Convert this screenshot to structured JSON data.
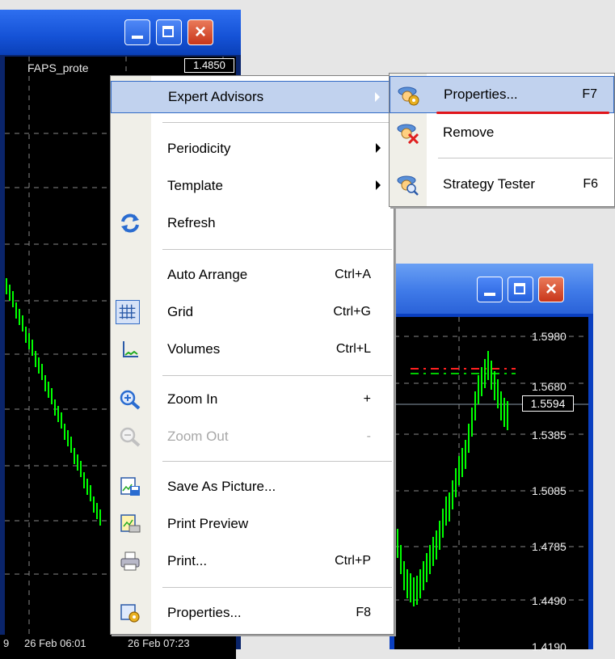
{
  "chart_window_left": {
    "ea_label": "FAPS_prote",
    "price_tag": "1.4850",
    "time_labels": [
      "9",
      "26 Feb 06:01",
      "26 Feb 07:23"
    ]
  },
  "chart_window_right": {
    "price_labels": [
      "1.5980",
      "1.5680",
      "1.5385",
      "1.5085",
      "1.4785",
      "1.4490",
      "1.4190"
    ],
    "current_price": "1.5594"
  },
  "context_menu": {
    "items": [
      {
        "label": "Expert Advisors",
        "shortcut": "",
        "submenu": true,
        "icon": "",
        "state": "highlighted"
      },
      {
        "label": "Periodicity",
        "shortcut": "",
        "submenu": true,
        "icon": ""
      },
      {
        "label": "Template",
        "shortcut": "",
        "submenu": true,
        "icon": ""
      },
      {
        "label": "Refresh",
        "shortcut": "",
        "submenu": false,
        "icon": "refresh-icon"
      },
      {
        "label": "Auto Arrange",
        "shortcut": "Ctrl+A",
        "submenu": false,
        "icon": ""
      },
      {
        "label": "Grid",
        "shortcut": "Ctrl+G",
        "submenu": false,
        "icon": "grid-icon",
        "checked": true
      },
      {
        "label": "Volumes",
        "shortcut": "Ctrl+L",
        "submenu": false,
        "icon": "volumes-icon"
      },
      {
        "label": "Zoom In",
        "shortcut": "+",
        "submenu": false,
        "icon": "zoom-in-icon"
      },
      {
        "label": "Zoom Out",
        "shortcut": "-",
        "submenu": false,
        "icon": "zoom-out-icon",
        "state": "disabled"
      },
      {
        "label": "Save As Picture...",
        "shortcut": "",
        "submenu": false,
        "icon": "save-picture-icon"
      },
      {
        "label": "Print Preview",
        "shortcut": "",
        "submenu": false,
        "icon": "print-preview-icon"
      },
      {
        "label": "Print...",
        "shortcut": "Ctrl+P",
        "submenu": false,
        "icon": "print-icon"
      },
      {
        "label": "Properties...",
        "shortcut": "F8",
        "submenu": false,
        "icon": "properties-icon"
      }
    ]
  },
  "expert_advisors_submenu": {
    "items": [
      {
        "label": "Properties...",
        "shortcut": "F7",
        "icon": "expert-properties-icon",
        "state": "highlighted"
      },
      {
        "label": "Remove",
        "shortcut": "",
        "icon": "expert-remove-icon"
      },
      {
        "label": "Strategy Tester",
        "shortcut": "F6",
        "icon": "strategy-tester-icon"
      }
    ]
  },
  "colors": {
    "menu_highlight": "#c1d2ee",
    "menu_highlight_border": "#316ac5",
    "annotation_underline": "#e0141a",
    "candle_green": "#00ff00",
    "chart_background": "#000000"
  }
}
